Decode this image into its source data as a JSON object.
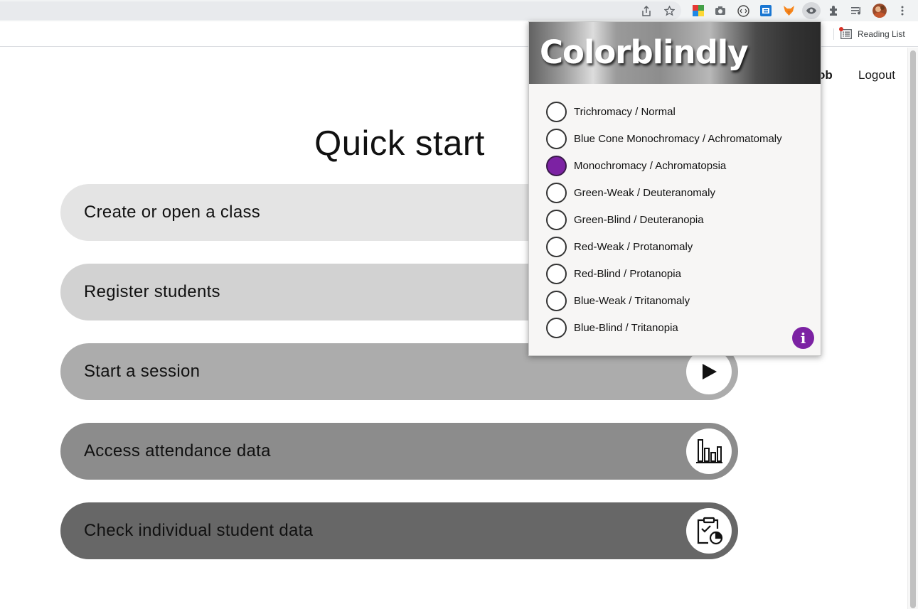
{
  "browser": {
    "reading_list_label": "Reading List",
    "toolbar_icons": [
      "share-icon",
      "star-icon",
      "extension-colorful-icon",
      "camera-icon",
      "code-icon",
      "translate-icon",
      "fox-icon",
      "eye-icon",
      "puzzle-icon",
      "media-queue-icon",
      "avatar",
      "more-icon"
    ]
  },
  "header": {
    "user_name_partial": "ob",
    "logout_label": "Logout"
  },
  "main": {
    "title": "Quick start",
    "actions": [
      {
        "label": "Create or open a class",
        "color": "#e4e4e4"
      },
      {
        "label": "Register students",
        "color": "#d2d2d2"
      },
      {
        "label": "Start a session",
        "color": "#acacac",
        "icon": "play-icon"
      },
      {
        "label": "Access attendance data",
        "color": "#8c8c8c",
        "icon": "bar-chart-icon"
      },
      {
        "label": "Check individual student data",
        "color": "#676767",
        "icon": "clipboard-chart-icon"
      }
    ]
  },
  "popup": {
    "title": "Colorblindly",
    "accent_color": "#7c22a3",
    "selected": "Monochromacy / Achromatopsia",
    "options": [
      "Trichromacy / Normal",
      "Blue Cone Monochromacy / Achromatomaly",
      "Monochromacy / Achromatopsia",
      "Green-Weak / Deuteranomaly",
      "Green-Blind / Deuteranopia",
      "Red-Weak / Protanomaly",
      "Red-Blind / Protanopia",
      "Blue-Weak / Tritanomaly",
      "Blue-Blind / Tritanopia"
    ],
    "info_icon": "i"
  }
}
